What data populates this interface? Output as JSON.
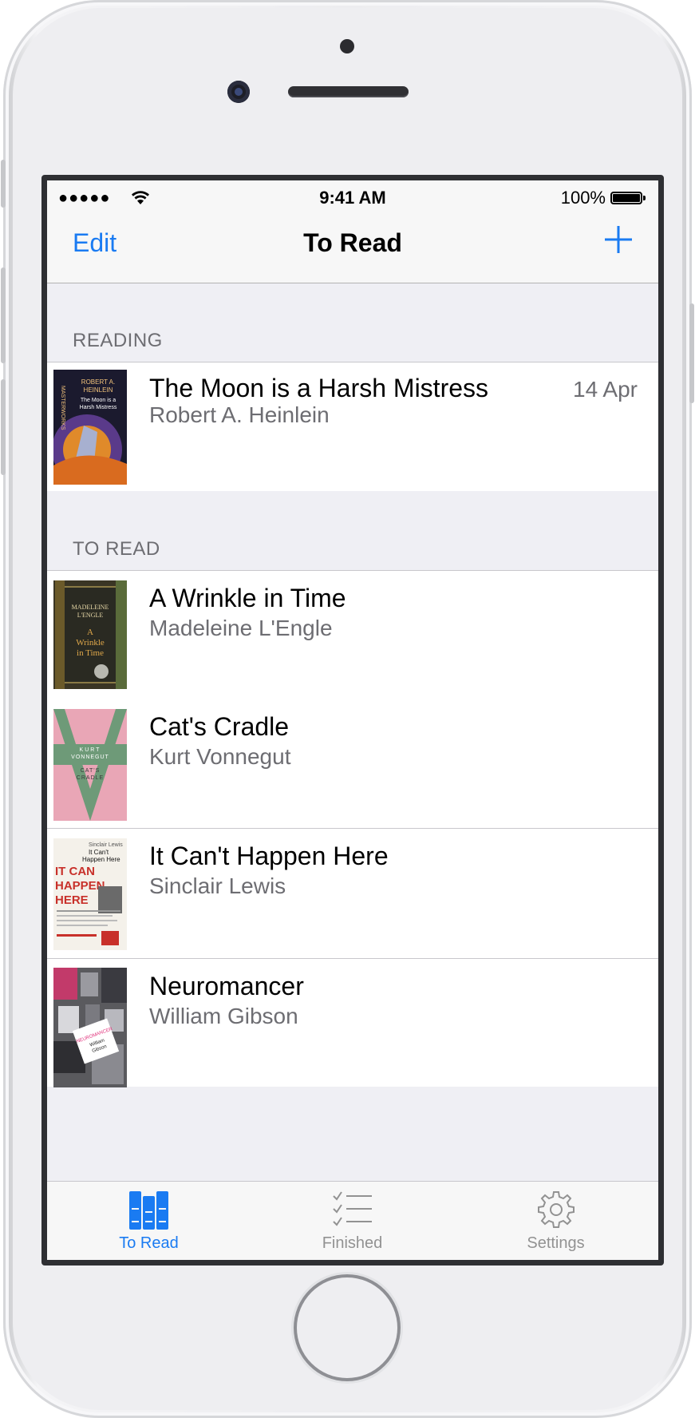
{
  "status_bar": {
    "signal": "●●●●●",
    "time": "9:41 AM",
    "battery": "100%"
  },
  "nav": {
    "edit_label": "Edit",
    "title": "To Read",
    "add_icon": "plus-icon"
  },
  "sections": [
    {
      "header": "READING",
      "rows": [
        {
          "title": "The Moon is a Harsh Mistress",
          "author": "Robert A. Heinlein",
          "date": "14 Apr"
        }
      ]
    },
    {
      "header": "TO READ",
      "rows": [
        {
          "title": "A Wrinkle in Time",
          "author": "Madeleine L'Engle"
        },
        {
          "title": "Cat's Cradle",
          "author": "Kurt Vonnegut"
        },
        {
          "title": "It Can't Happen Here",
          "author": "Sinclair Lewis"
        },
        {
          "title": "Neuromancer",
          "author": "William Gibson"
        }
      ]
    }
  ],
  "covers": {
    "moon": {
      "lines": [
        "ROBERT A.",
        "HEINLEIN",
        "The Moon is a",
        "Harsh Mistress"
      ],
      "spine": "MASTERWORKS"
    },
    "wrinkle": {
      "lines": [
        "MADELEINE",
        "L'ENGLE",
        "A",
        "Wrinkle",
        "in Time"
      ]
    },
    "cradle": {
      "lines": [
        "KURT",
        "VONNEGUT",
        "CAT'S",
        "CRADLE"
      ]
    },
    "happen": {
      "lines": [
        "Sinclair Lewis",
        "It Can't",
        "Happen Here",
        "IT CAN",
        "HAPPEN",
        "HERE"
      ]
    },
    "neuromancer": {
      "lines": [
        "NEUROMANCER",
        "William",
        "Gibson"
      ]
    }
  },
  "tabs": [
    {
      "label": "To Read",
      "icon": "books-icon",
      "active": true
    },
    {
      "label": "Finished",
      "icon": "checklist-icon",
      "active": false
    },
    {
      "label": "Settings",
      "icon": "gear-icon",
      "active": false
    }
  ],
  "colors": {
    "accent": "#1a7bf2",
    "inactive_tab": "#929292",
    "section_bg": "#efeff4"
  }
}
